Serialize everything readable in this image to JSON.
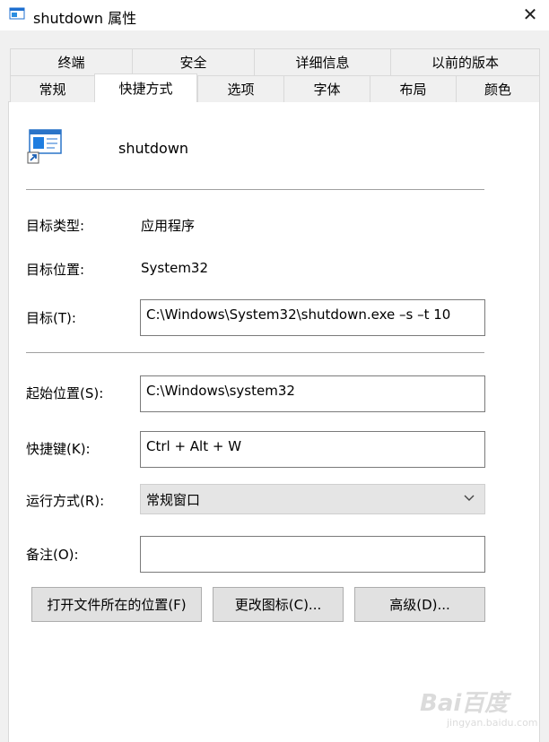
{
  "window": {
    "title": "shutdown 属性",
    "close_label": "✕"
  },
  "tabs": {
    "back_row": [
      "终端",
      "安全",
      "详细信息",
      "以前的版本"
    ],
    "front_row": [
      "常规",
      "快捷方式",
      "选项",
      "字体",
      "布局",
      "颜色"
    ],
    "active": "快捷方式"
  },
  "shortcut": {
    "name": "shutdown",
    "target_type_label": "目标类型:",
    "target_type_value": "应用程序",
    "target_location_label": "目标位置:",
    "target_location_value": "System32",
    "target_label": "目标(T):",
    "target_value": "C:\\Windows\\System32\\shutdown.exe –s –t 10",
    "start_in_label": "起始位置(S):",
    "start_in_value": "C:\\Windows\\system32",
    "hotkey_label": "快捷键(K):",
    "hotkey_value": "Ctrl + Alt + W",
    "run_label": "运行方式(R):",
    "run_value": "常规窗口",
    "comment_label": "备注(O):",
    "comment_value": ""
  },
  "buttons": {
    "open_location": "打开文件所在的位置(F)",
    "change_icon": "更改图标(C)...",
    "advanced": "高级(D)..."
  },
  "watermark": {
    "main": "Bai百度",
    "sub": "jingyan.baidu.com"
  }
}
